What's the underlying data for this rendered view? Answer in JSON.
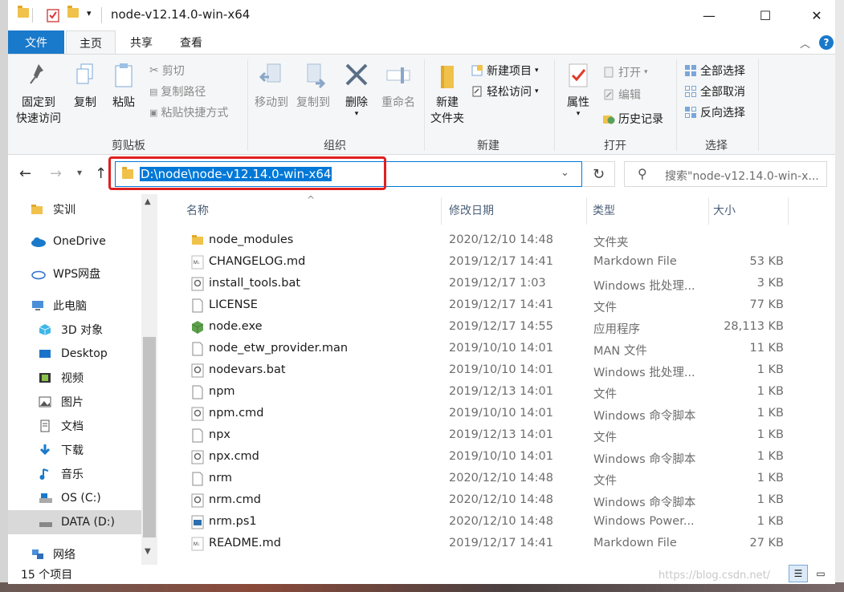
{
  "window": {
    "title": "node-v12.14.0-win-x64",
    "minimize": "—",
    "maximize": "☐",
    "close": "✕"
  },
  "tabs": [
    "文件",
    "主页",
    "共享",
    "查看"
  ],
  "ribbon": {
    "clipboard": {
      "label": "剪贴板",
      "pin_line1": "固定到",
      "pin_line2": "快速访问",
      "copy": "复制",
      "paste": "粘贴",
      "cut": "剪切",
      "copy_path": "复制路径",
      "paste_shortcut": "粘贴快捷方式"
    },
    "organize": {
      "label": "组织",
      "move_to": "移动到",
      "copy_to": "复制到",
      "delete": "删除",
      "rename": "重命名"
    },
    "new": {
      "label": "新建",
      "new_folder_line1": "新建",
      "new_folder_line2": "文件夹",
      "new_item": "新建项目",
      "easy_access": "轻松访问"
    },
    "open": {
      "label": "打开",
      "properties": "属性",
      "open": "打开",
      "edit": "编辑",
      "history": "历史记录"
    },
    "select": {
      "label": "选择",
      "select_all": "全部选择",
      "select_none": "全部取消",
      "invert": "反向选择"
    }
  },
  "address": {
    "path": "D:\\node\\node-v12.14.0-win-x64",
    "search_placeholder": "搜索\"node-v12.14.0-win-x..."
  },
  "sidebar": [
    {
      "label": "实训",
      "icon": "folder-icon"
    },
    {
      "label": "OneDrive",
      "icon": "cloud-icon"
    },
    {
      "label": "WPS网盘",
      "icon": "cloud-outline-icon"
    },
    {
      "label": "此电脑",
      "icon": "computer-icon"
    },
    {
      "label": "3D 对象",
      "icon": "cube-icon"
    },
    {
      "label": "Desktop",
      "icon": "desktop-icon"
    },
    {
      "label": "视频",
      "icon": "video-icon"
    },
    {
      "label": "图片",
      "icon": "picture-icon"
    },
    {
      "label": "文档",
      "icon": "document-icon"
    },
    {
      "label": "下载",
      "icon": "download-icon"
    },
    {
      "label": "音乐",
      "icon": "music-icon"
    },
    {
      "label": "OS (C:)",
      "icon": "drive-c-icon"
    },
    {
      "label": "DATA (D:)",
      "icon": "drive-d-icon"
    },
    {
      "label": "网络",
      "icon": "network-icon"
    }
  ],
  "columns": {
    "name": "名称",
    "date": "修改日期",
    "type": "类型",
    "size": "大小"
  },
  "files": [
    {
      "name": "node_modules",
      "date": "2020/12/10 14:48",
      "type": "文件夹",
      "size": "",
      "icon": "folder-icon"
    },
    {
      "name": "CHANGELOG.md",
      "date": "2019/12/17 14:41",
      "type": "Markdown File",
      "size": "53 KB",
      "icon": "markdown-file-icon"
    },
    {
      "name": "install_tools.bat",
      "date": "2019/12/17 1:03",
      "type": "Windows 批处理...",
      "size": "3 KB",
      "icon": "batch-file-icon"
    },
    {
      "name": "LICENSE",
      "date": "2019/12/17 14:41",
      "type": "文件",
      "size": "77 KB",
      "icon": "blank-file-icon"
    },
    {
      "name": "node.exe",
      "date": "2019/12/17 14:55",
      "type": "应用程序",
      "size": "28,113 KB",
      "icon": "node-exe-icon"
    },
    {
      "name": "node_etw_provider.man",
      "date": "2019/10/10 14:01",
      "type": "MAN 文件",
      "size": "11 KB",
      "icon": "blank-file-icon"
    },
    {
      "name": "nodevars.bat",
      "date": "2019/10/10 14:01",
      "type": "Windows 批处理...",
      "size": "1 KB",
      "icon": "batch-file-icon"
    },
    {
      "name": "npm",
      "date": "2019/12/13 14:01",
      "type": "文件",
      "size": "1 KB",
      "icon": "blank-file-icon"
    },
    {
      "name": "npm.cmd",
      "date": "2019/10/10 14:01",
      "type": "Windows 命令脚本",
      "size": "1 KB",
      "icon": "cmd-file-icon"
    },
    {
      "name": "npx",
      "date": "2019/12/13 14:01",
      "type": "文件",
      "size": "1 KB",
      "icon": "blank-file-icon"
    },
    {
      "name": "npx.cmd",
      "date": "2019/10/10 14:01",
      "type": "Windows 命令脚本",
      "size": "1 KB",
      "icon": "cmd-file-icon"
    },
    {
      "name": "nrm",
      "date": "2020/12/10 14:48",
      "type": "文件",
      "size": "1 KB",
      "icon": "blank-file-icon"
    },
    {
      "name": "nrm.cmd",
      "date": "2020/12/10 14:48",
      "type": "Windows 命令脚本",
      "size": "1 KB",
      "icon": "cmd-file-icon"
    },
    {
      "name": "nrm.ps1",
      "date": "2020/12/10 14:48",
      "type": "Windows Power...",
      "size": "1 KB",
      "icon": "powershell-file-icon"
    },
    {
      "name": "README.md",
      "date": "2019/12/17 14:41",
      "type": "Markdown File",
      "size": "27 KB",
      "icon": "markdown-file-icon"
    }
  ],
  "status": {
    "count": "15 个项目"
  },
  "watermark": "https://blog.csdn.net/",
  "colors": {
    "accent": "#0078d7",
    "file_tab": "#1979ca",
    "highlight_box": "#e02020",
    "folder": "#f0c24b"
  }
}
